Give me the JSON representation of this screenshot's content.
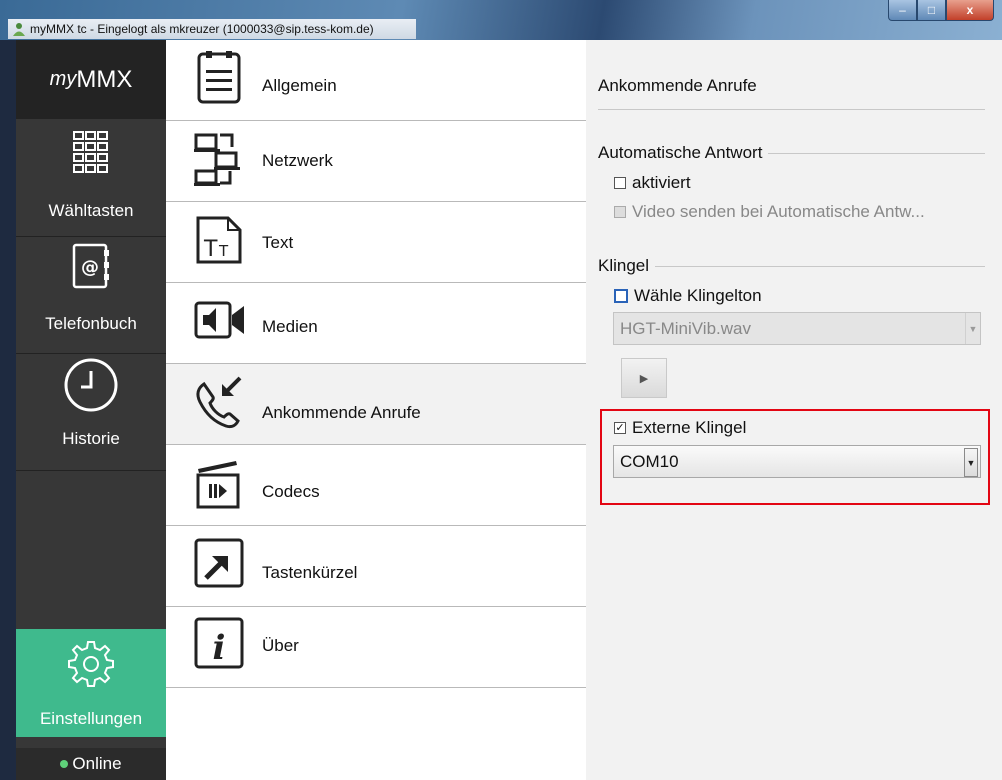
{
  "window": {
    "title": "myMMX tc - Eingelogt als mkreuzer (1000033@sip.tess-kom.de)",
    "buttons": {
      "minimize": "–",
      "maximize": "□",
      "close": "x"
    }
  },
  "sidebar": {
    "logo_prefix": "my",
    "logo_main": "MMX",
    "items": [
      {
        "label": "Wähltasten",
        "icon": "dialpad-icon"
      },
      {
        "label": "Telefonbuch",
        "icon": "phonebook-icon"
      },
      {
        "label": "Historie",
        "icon": "clock-icon"
      }
    ],
    "settings_label": "Einstellungen",
    "status_label": "Online",
    "status_color": "#5fd17a",
    "active_color": "#3fba8d"
  },
  "menu": {
    "items": [
      {
        "label": "Allgemein",
        "icon": "notepad-icon"
      },
      {
        "label": "Netzwerk",
        "icon": "network-icon"
      },
      {
        "label": "Text",
        "icon": "text-icon"
      },
      {
        "label": "Medien",
        "icon": "media-icon"
      },
      {
        "label": "Ankommende Anrufe",
        "icon": "incoming-call-icon"
      },
      {
        "label": "Codecs",
        "icon": "clapperboard-icon"
      },
      {
        "label": "Tastenkürzel",
        "icon": "shortcut-icon"
      },
      {
        "label": "Über",
        "icon": "info-icon"
      }
    ],
    "selected_index": 4
  },
  "panel": {
    "title": "Ankommende Anrufe",
    "auto_answer": {
      "heading": "Automatische Antwort",
      "activated_label": "aktiviert",
      "activated_checked": false,
      "video_label": "Video senden bei Automatische Antw...",
      "video_checked": false,
      "video_enabled": false
    },
    "ring": {
      "heading": "Klingel",
      "choose_tone_label": "Wähle Klingelton",
      "choose_tone_checked": false,
      "tone_value": "HGT-MiniVib.wav",
      "external_label": "Externe Klingel",
      "external_checked": true,
      "port_value": "COM10"
    },
    "highlight_color": "#e30613"
  }
}
